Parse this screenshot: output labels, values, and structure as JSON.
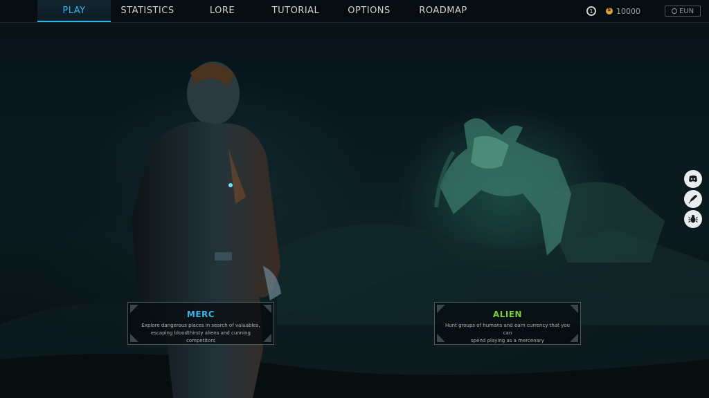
{
  "nav": {
    "tabs": [
      {
        "label": "PLAY",
        "active": true
      },
      {
        "label": "STATISTICS",
        "active": false
      },
      {
        "label": "LORE",
        "active": false
      },
      {
        "label": "TUTORIAL",
        "active": false
      },
      {
        "label": "OPTIONS",
        "active": false
      },
      {
        "label": "ROADMAP",
        "active": false
      }
    ]
  },
  "status": {
    "level": "1",
    "currency": "10000",
    "region": "EUN"
  },
  "social": [
    {
      "name": "discord-icon"
    },
    {
      "name": "feedback-icon"
    },
    {
      "name": "bug-report-icon"
    }
  ],
  "cards": {
    "merc": {
      "title": "MERC",
      "desc_line1": "Explore dangerous places in search of valuables,",
      "desc_line2": "escaping bloodthirsty aliens and cunning competitors"
    },
    "alien": {
      "title": "ALIEN",
      "desc_line1": "Hunt groups of humans and earn currency that you can",
      "desc_line2": "spend playing as a mercenary"
    }
  },
  "colors": {
    "accent": "#2fb6f0",
    "merc_title": "#3ab4ee",
    "alien_title": "#7ccc3a",
    "coin": "#d9a23a"
  }
}
